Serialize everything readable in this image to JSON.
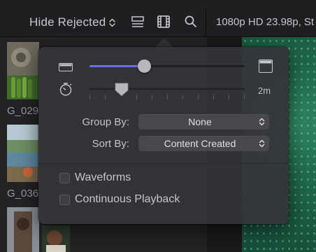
{
  "toolbar": {
    "filter_label": "Hide Rejected",
    "icons": [
      "clip-appearance-icon",
      "filmstrip-icon",
      "search-icon"
    ],
    "format_text": "1080p HD 23.98p, St"
  },
  "browser": {
    "clip_labels": [
      "G_029",
      "G_036"
    ]
  },
  "popover": {
    "duration_value": "2m",
    "group_by_label": "Group By:",
    "group_by_value": "None",
    "sort_by_label": "Sort By:",
    "sort_by_value": "Content Created",
    "waveforms_label": "Waveforms",
    "waveforms_checked": false,
    "continuous_playback_label": "Continuous Playback",
    "continuous_playback_checked": false,
    "clip_height_level": 0.35,
    "accent_color": "#6b6cf0"
  }
}
